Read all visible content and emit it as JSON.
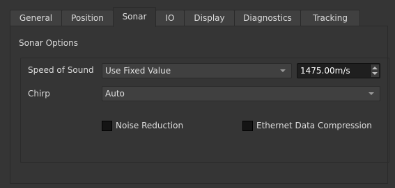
{
  "tabs": [
    {
      "label": "General",
      "active": false
    },
    {
      "label": "Position",
      "active": false
    },
    {
      "label": "Sonar",
      "active": true
    },
    {
      "label": "IO",
      "active": false
    },
    {
      "label": "Display",
      "active": false
    },
    {
      "label": "Diagnostics",
      "active": false
    },
    {
      "label": "Tracking",
      "active": false
    }
  ],
  "sonar_options": {
    "title": "Sonar Options",
    "speed_of_sound": {
      "label": "Speed of Sound",
      "mode_value": "Use Fixed Value",
      "fixed_value": "1475.00m/s"
    },
    "chirp": {
      "label": "Chirp",
      "value": "Auto"
    },
    "noise_reduction": {
      "label": "Noise Reduction",
      "checked": false
    },
    "ethernet_compression": {
      "label": "Ethernet Data Compression",
      "checked": false
    }
  },
  "icons": {
    "dropdown": "chevron-down-icon",
    "spin": "spin-arrows-icon"
  }
}
